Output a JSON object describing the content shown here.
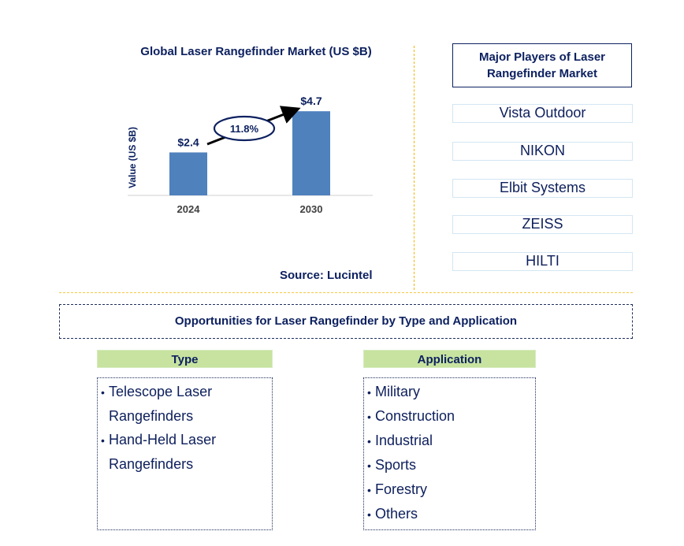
{
  "chart_data": {
    "type": "bar",
    "title": "Global Laser Rangefinder Market (US $B)",
    "xlabel": "",
    "ylabel": "Value (US $B)",
    "categories": [
      "2024",
      "2030"
    ],
    "values": [
      2.4,
      4.7
    ],
    "data_labels": [
      "$2.4",
      "$4.7"
    ],
    "ylim": [
      0,
      5.5
    ],
    "grid": false,
    "annotation": {
      "type": "cagr-arrow",
      "label": "11.8%"
    },
    "bar_color": "#4f81bd"
  },
  "source": "Source: Lucintel",
  "players": {
    "title": "Major Players of Laser Rangefinder Market",
    "items": [
      "Vista Outdoor",
      "NIKON",
      "Elbit Systems",
      "ZEISS",
      "HILTI"
    ]
  },
  "opportunities": {
    "title": "Opportunities for Laser Rangefinder by Type and Application",
    "type": {
      "heading": "Type",
      "items": [
        "Telescope Laser Rangefinders",
        "Hand-Held Laser Rangefinders"
      ]
    },
    "application": {
      "heading": "Application",
      "items": [
        "Military",
        "Construction",
        "Industrial",
        "Sports",
        "Forestry",
        "Others"
      ]
    }
  }
}
